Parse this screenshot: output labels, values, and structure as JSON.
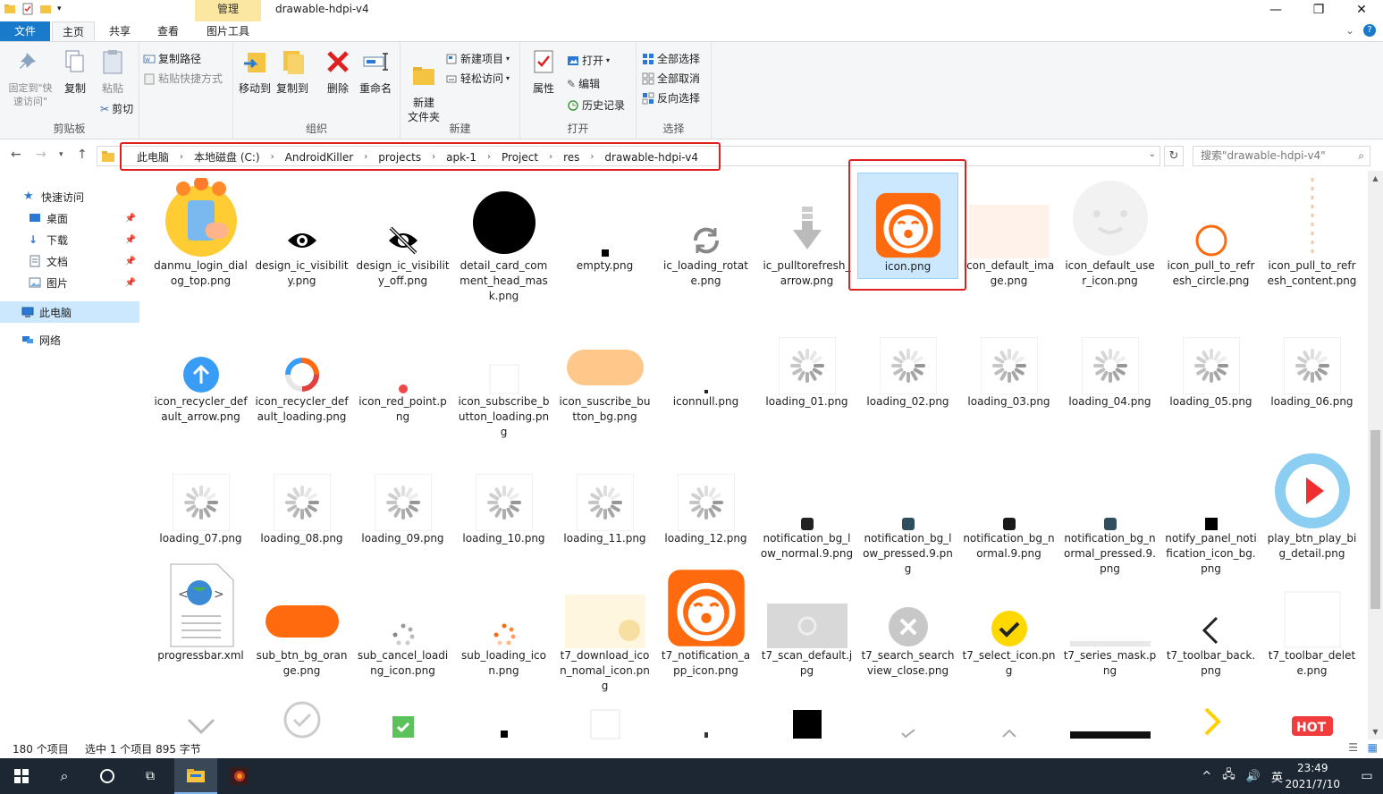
{
  "window": {
    "title": "drawable-hdpi-v4",
    "context_tab": "管理",
    "controls": [
      "—",
      "❐",
      "✕"
    ]
  },
  "tabs": {
    "file": "文件",
    "home": "主页",
    "share": "共享",
    "view": "查看",
    "picture_tools": "图片工具"
  },
  "ribbon": {
    "clipboard": {
      "label": "剪贴板",
      "pin_quick": "固定到\"快速访问\"",
      "copy": "复制",
      "paste": "粘贴",
      "copy_path": "复制路径",
      "paste_shortcut": "粘贴快捷方式",
      "cut": "剪切"
    },
    "organize": {
      "label": "组织",
      "move_to": "移动到",
      "copy_to": "复制到",
      "delete": "删除",
      "rename": "重命名"
    },
    "new": {
      "label": "新建",
      "new_folder": "新建\n文件夹",
      "new_item": "新建项目",
      "easy_access": "轻松访问"
    },
    "open": {
      "label": "打开",
      "properties": "属性",
      "open": "打开",
      "edit": "编辑",
      "history": "历史记录"
    },
    "select": {
      "label": "选择",
      "select_all": "全部选择",
      "select_none": "全部取消",
      "invert": "反向选择"
    }
  },
  "address": {
    "crumbs": [
      "此电脑",
      "本地磁盘 (C:)",
      "AndroidKiller",
      "projects",
      "apk-1",
      "Project",
      "res",
      "drawable-hdpi-v4"
    ],
    "search_placeholder": "搜索\"drawable-hdpi-v4\""
  },
  "nav": {
    "quick_access": "快速访问",
    "desktop": "桌面",
    "downloads": "下载",
    "documents": "文档",
    "pictures": "图片",
    "this_pc": "此电脑",
    "network": "网络"
  },
  "files": [
    [
      "danmu_login_dialog_top.png",
      "design_ic_visibility.png",
      "design_ic_visibility_off.png",
      "detail_card_comment_head_mask.png",
      "empty.png",
      "ic_loading_rotate.png",
      "ic_pulltorefresh_arrow.png",
      "icon.png",
      "icon_default_image.png",
      "icon_default_user_icon.png",
      "icon_pull_to_refresh_circle.png",
      "icon_pull_to_refresh_content.png"
    ],
    [
      "icon_recycler_default_arrow.png",
      "icon_recycler_default_loading.png",
      "icon_red_point.png",
      "icon_subscribe_button_loading.png",
      "icon_suscribe_button_bg.png",
      "iconnull.png",
      "loading_01.png",
      "loading_02.png",
      "loading_03.png",
      "loading_04.png",
      "loading_05.png",
      "loading_06.png"
    ],
    [
      "loading_07.png",
      "loading_08.png",
      "loading_09.png",
      "loading_10.png",
      "loading_11.png",
      "loading_12.png",
      "notification_bg_low_normal.9.png",
      "notification_bg_low_pressed.9.png",
      "notification_bg_normal.9.png",
      "notification_bg_normal_pressed.9.png",
      "notify_panel_notification_icon_bg.png",
      "play_btn_play_big_detail.png"
    ],
    [
      "progressbar.xml",
      "sub_btn_bg_orange.png",
      "sub_cancel_loading_icon.png",
      "sub_loading_icon.png",
      "t7_download_icon_nomal_icon.png",
      "t7_notification_app_icon.png",
      "t7_scan_default.jpg",
      "t7_search_searchview_close.png",
      "t7_select_icon.png",
      "t7_series_mask.png",
      "t7_toolbar_back.png",
      "t7_toolbar_delete.png"
    ]
  ],
  "status": {
    "count": "180 个项目",
    "selection": "选中 1 个项目  895 字节"
  },
  "taskbar": {
    "time": "23:49",
    "date": "2021/7/10",
    "ime": "英"
  },
  "colors": {
    "accent": "#1979ca",
    "highlight_red": "#e02020",
    "brand_orange": "#ff6a0f",
    "selection": "#cce8ff"
  }
}
